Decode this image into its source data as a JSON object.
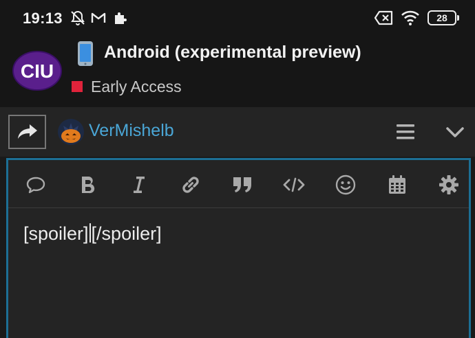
{
  "status_bar": {
    "time": "19:13",
    "battery_level": "28",
    "icons": [
      "bell-off-icon",
      "gmail-icon",
      "puzzle-icon",
      "no-sim-icon",
      "wifi-icon",
      "battery-icon"
    ]
  },
  "topic": {
    "logo_text": "CIU",
    "title": "Android (experimental preview)",
    "title_icon": "phone-emoji-icon",
    "category": "Early Access",
    "category_color": "#e0233b"
  },
  "reply": {
    "username": "VerMishelb",
    "username_color": "#4aa6d6",
    "icons": [
      "reply-share-icon",
      "avatar",
      "hamburger-menu-icon",
      "chevron-down-icon"
    ]
  },
  "editor": {
    "accent_color": "#1c6f95",
    "toolbar": [
      "speech-bubble-icon",
      "bold-icon",
      "italic-icon",
      "link-icon",
      "quote-icon",
      "code-icon",
      "emoji-icon",
      "calendar-icon",
      "gear-icon"
    ],
    "text_before_caret": "[spoiler]",
    "text_after_caret": "[/spoiler]"
  }
}
